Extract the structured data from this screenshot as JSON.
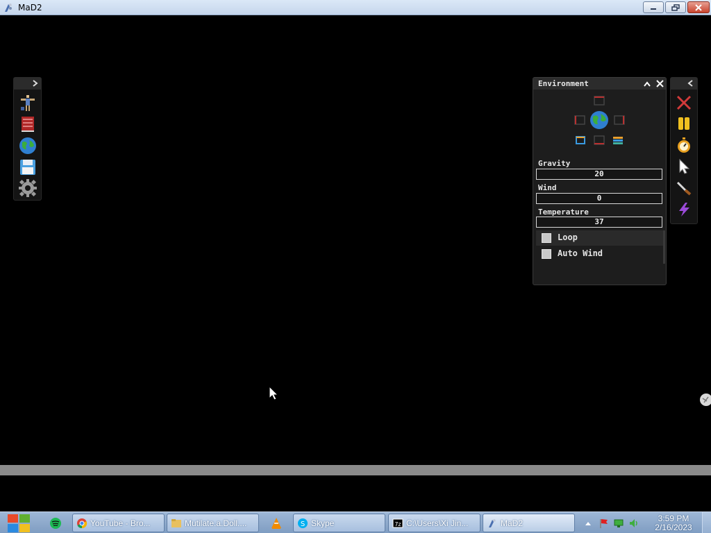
{
  "window": {
    "title": "MaD2",
    "icon": "mad2-app-icon"
  },
  "left_toolbar": {
    "icons": [
      "ragdoll-icon",
      "book-icon",
      "globe-icon",
      "save-disk-icon",
      "settings-gear-icon"
    ]
  },
  "environment": {
    "title": "Environment",
    "gravity_label": "Gravity",
    "gravity_value": "20",
    "wind_label": "Wind",
    "wind_value": "0",
    "temperature_label": "Temperature",
    "temperature_value": "37",
    "loop_label": "Loop",
    "loop_checked": false,
    "auto_wind_label": "Auto Wind",
    "auto_wind_checked": false
  },
  "right_toolbar": {
    "icons": [
      "clear-x-icon",
      "pause-icon",
      "stopwatch-icon",
      "pointer-icon",
      "knife-icon",
      "lightning-icon"
    ]
  },
  "taskbar": {
    "items": [
      {
        "label": "YouTube - Bro...",
        "icon": "chrome-icon"
      },
      {
        "label": "Mutilate.a.Doll....",
        "icon": "folder-icon"
      },
      {
        "label": "Skype",
        "icon": "skype-icon"
      },
      {
        "label": "C:\\Users\\Xi Jin...",
        "icon": "7zip-icon"
      },
      {
        "label": "MaD2",
        "icon": "mad2-app-icon"
      }
    ],
    "time": "3:59 PM",
    "date": "2/16/2023"
  },
  "colors": {
    "panel_bg": "#1d1d1d",
    "taskbar_top": "#9eb7d6",
    "accent_red": "#d23a3a"
  }
}
